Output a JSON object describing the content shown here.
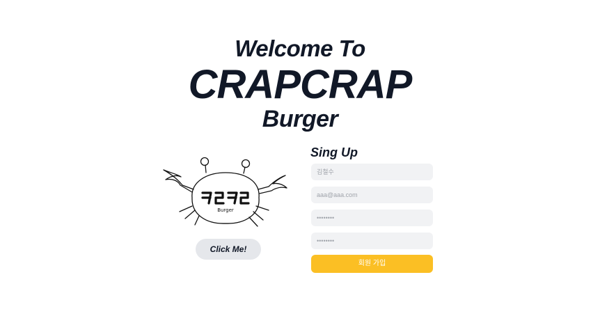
{
  "hero": {
    "line1": "Welcome To",
    "line2": "CRAPCRAP",
    "line3": "Burger"
  },
  "logo": {
    "text": "ㅋㄹㅋㄹ",
    "subtext": "Burger"
  },
  "click_button": {
    "label": "Click Me!"
  },
  "signup": {
    "title": "Sing Up",
    "name_placeholder": "김철수",
    "email_placeholder": "aaa@aaa.com",
    "password_placeholder": "••••••••",
    "password_confirm_placeholder": "••••••••",
    "submit_label": "회원 가입"
  },
  "colors": {
    "text": "#111827",
    "field_bg": "#f1f2f4",
    "button_gray": "#e5e7eb",
    "accent": "#fbbf24"
  }
}
